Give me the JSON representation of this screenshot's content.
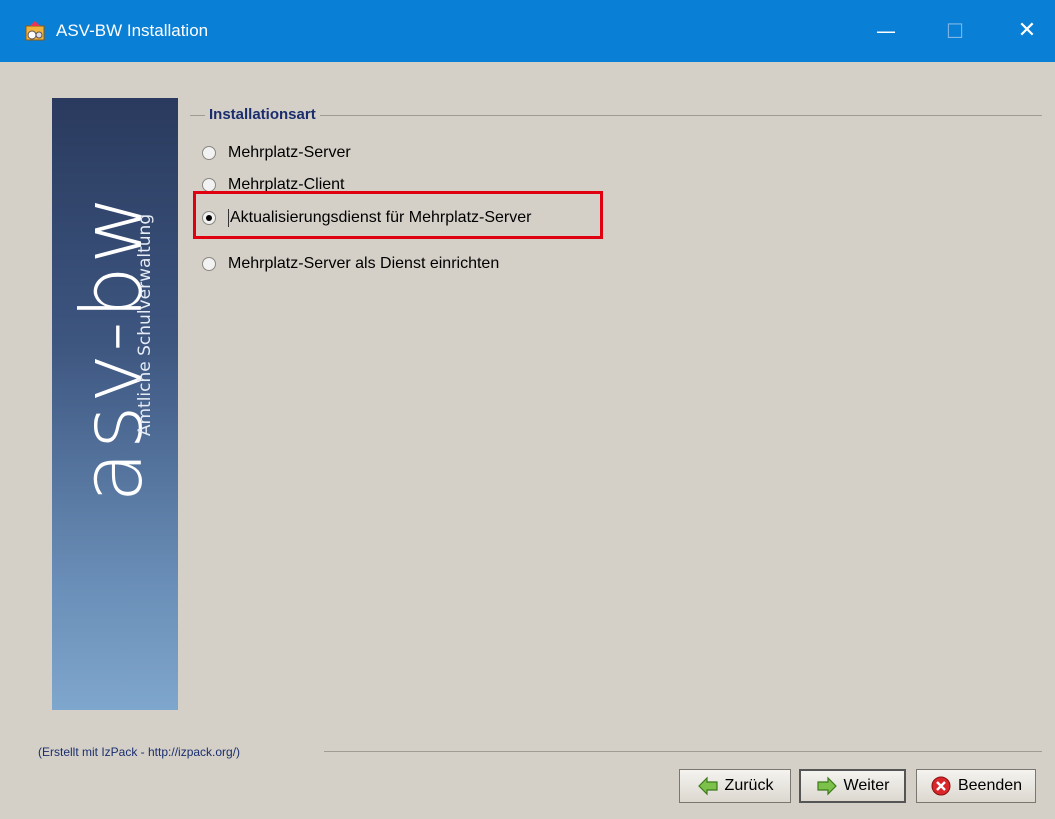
{
  "window": {
    "title": "ASV-BW Installation",
    "controls": {
      "minimize": "—",
      "maximize": "☐",
      "close": "✕"
    }
  },
  "side_panel": {
    "logo_text": "asv-bw",
    "subtitle": "Amtliche Schulverwaltung"
  },
  "installation_group": {
    "title": "Installationsart",
    "options": [
      {
        "label": "Mehrplatz-Server",
        "selected": false
      },
      {
        "label": "Mehrplatz-Client",
        "selected": false
      },
      {
        "label": "Aktualisierungsdienst für Mehrplatz-Server",
        "selected": true
      },
      {
        "label": "Mehrplatz-Server als Dienst einrichten",
        "selected": false
      }
    ]
  },
  "footer": {
    "credit": "(Erstellt mit IzPack - http://izpack.org/)"
  },
  "buttons": {
    "back": "Zurück",
    "next": "Weiter",
    "quit": "Beenden"
  },
  "colors": {
    "titlebar": "#0a7fd6",
    "background": "#d4d0c8",
    "group_title": "#1a2e6e",
    "highlight": "#e0000f"
  }
}
